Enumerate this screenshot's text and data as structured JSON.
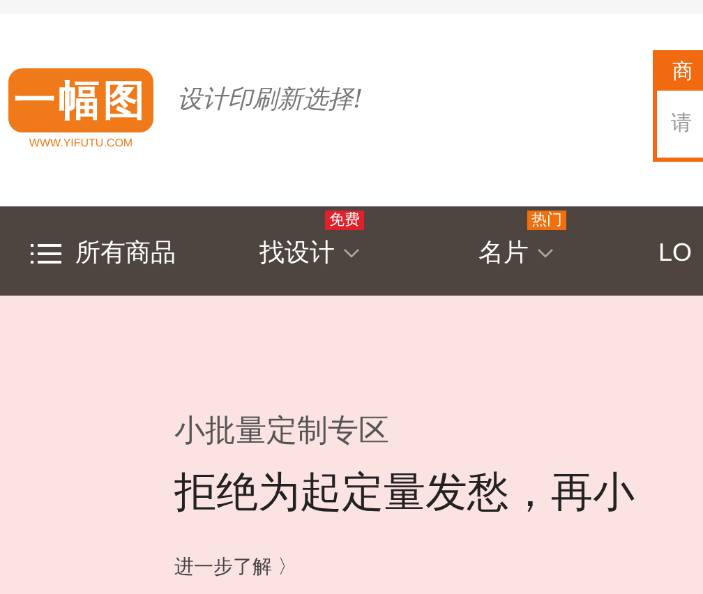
{
  "header": {
    "logo": {
      "mark": "一幅图",
      "url": "WWW.YIFUTU.COM"
    },
    "slogan": "设计印刷新选择!",
    "search": {
      "tab": "商",
      "placeholder": "请"
    }
  },
  "nav": {
    "items": [
      {
        "kind": "menu",
        "label": "所有商品"
      },
      {
        "kind": "dropdown",
        "label": "找设计",
        "badge": "免费",
        "color": "#e0202a"
      },
      {
        "kind": "dropdown",
        "label": "名片",
        "badge": "热门",
        "color": "#f07010"
      },
      {
        "kind": "link",
        "label": "LO"
      }
    ]
  },
  "banner": {
    "eyebrow": "小批量定制专区",
    "headline": "拒绝为起定量发愁，再小",
    "link": "进一步了解 〉"
  }
}
